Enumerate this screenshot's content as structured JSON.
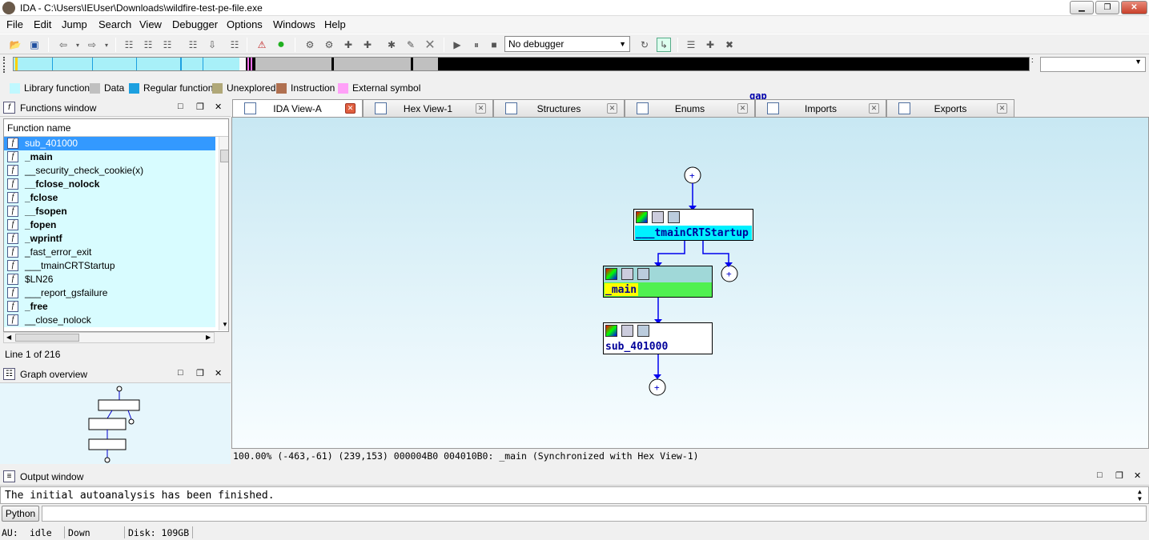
{
  "window": {
    "title": "IDA - C:\\Users\\IEUser\\Downloads\\wildfire-test-pe-file.exe"
  },
  "menu": [
    "File",
    "Edit",
    "Jump",
    "Search",
    "View",
    "Debugger",
    "Options",
    "Windows",
    "Help"
  ],
  "toolbar": {
    "debugger_select": "No debugger"
  },
  "legend": [
    {
      "label": "Library function",
      "color": "#c0f8ff"
    },
    {
      "label": "Data",
      "color": "#c0c0c0"
    },
    {
      "label": "Regular function",
      "color": "#1ca0e0"
    },
    {
      "label": "Unexplored",
      "color": "#b0a878"
    },
    {
      "label": "Instruction",
      "color": "#b07050"
    },
    {
      "label": "External symbol",
      "color": "#ffa0f8"
    }
  ],
  "functions_window": {
    "title": "Functions window",
    "column": "Function name",
    "rows": [
      {
        "name": "sub_401000",
        "bold": false,
        "selected": true
      },
      {
        "name": "_main",
        "bold": true
      },
      {
        "name": "__security_check_cookie(x)",
        "bold": false
      },
      {
        "name": "__fclose_nolock",
        "bold": true
      },
      {
        "name": "_fclose",
        "bold": true
      },
      {
        "name": "__fsopen",
        "bold": true
      },
      {
        "name": "_fopen",
        "bold": true
      },
      {
        "name": "_wprintf",
        "bold": true
      },
      {
        "name": "_fast_error_exit",
        "bold": false
      },
      {
        "name": "___tmainCRTStartup",
        "bold": false
      },
      {
        "name": "$LN26",
        "bold": false
      },
      {
        "name": "___report_gsfailure",
        "bold": false
      },
      {
        "name": "_free",
        "bold": true
      },
      {
        "name": "__close_nolock",
        "bold": false
      }
    ],
    "line_info": "Line 1 of 216"
  },
  "graph_overview": {
    "title": "Graph overview"
  },
  "tabs": [
    {
      "label": "IDA View-A",
      "active": true
    },
    {
      "label": "Hex View-1"
    },
    {
      "label": "Structures"
    },
    {
      "label": "Enums"
    },
    {
      "label": "Imports"
    },
    {
      "label": "Exports"
    }
  ],
  "gap_label": "gap",
  "graph": {
    "nodes": [
      {
        "label": "___tmainCRTStartup"
      },
      {
        "label": "_main"
      },
      {
        "label": "sub_401000"
      }
    ]
  },
  "status_line": "100.00% (-463,-61) (239,153) 000004B0 004010B0: _main (Synchronized with Hex View-1)",
  "output_window": {
    "title": "Output window",
    "text": "The initial autoanalysis has been finished."
  },
  "python_button": "Python",
  "bottom": {
    "au_label": "AU:",
    "au_state": "idle",
    "direction": "Down",
    "disk": "Disk: 109GB"
  }
}
